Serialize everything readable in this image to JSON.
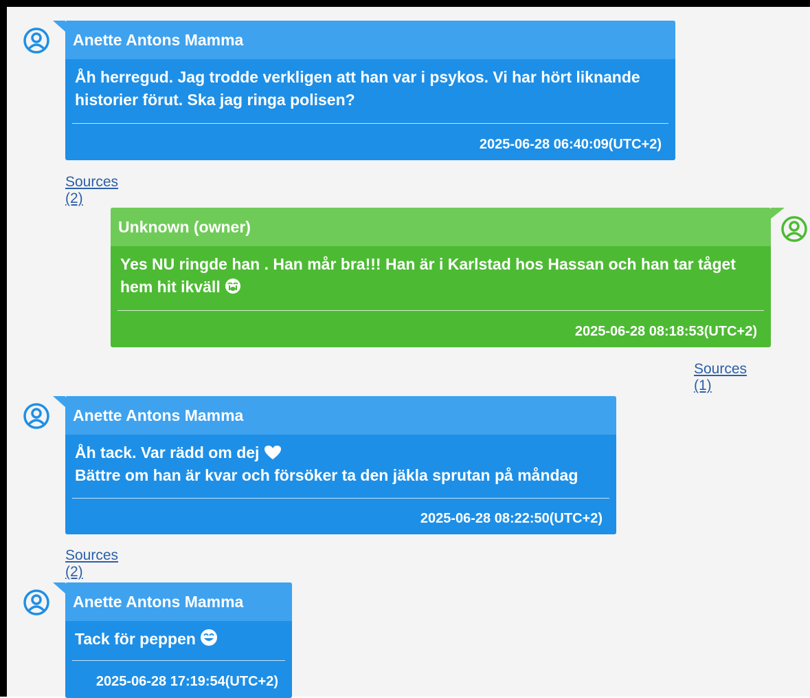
{
  "colors": {
    "incoming_header": "#3ea2ef",
    "incoming_body": "#1e8fe6",
    "outgoing_header": "#6fcb58",
    "outgoing_body": "#4dba34",
    "link": "#2b5fa8"
  },
  "messages": [
    {
      "direction": "incoming",
      "sender": "Anette Antons Mamma",
      "lines": [
        "Åh herregud. Jag trodde verkligen att han var i psykos. Vi har hört liknande",
        "historier förut. Ska jag ringa polisen?"
      ],
      "timestamp": "2025-06-28 06:40:09(UTC+2)",
      "sources": "Sources (2)",
      "avatar_icon": "user-avatar-icon"
    },
    {
      "direction": "outgoing",
      "sender": "Unknown (owner)",
      "lines": [
        "Yes NU ringde han . Han mår bra!!! Han är i Karlstad hos Hassan och han tar tåget",
        "hem hit ikväll"
      ],
      "emoji": "crying-face-emoji",
      "timestamp": "2025-06-28 08:18:53(UTC+2)",
      "sources": "Sources (1)",
      "avatar_icon": "user-avatar-icon"
    },
    {
      "direction": "incoming",
      "sender": "Anette Antons Mamma",
      "lines": [
        "Åh tack. Var rädd om dej",
        "Bättre om han är kvar och försöker  ta den jäkla sprutan på måndag"
      ],
      "emoji": "heart-emoji",
      "timestamp": "2025-06-28 08:22:50(UTC+2)",
      "sources": "Sources (2)",
      "avatar_icon": "user-avatar-icon"
    },
    {
      "direction": "incoming",
      "sender": "Anette Antons Mamma",
      "lines": [
        "Tack för peppen"
      ],
      "emoji": "smiling-face-emoji",
      "timestamp": "2025-06-28 17:19:54(UTC+2)",
      "avatar_icon": "user-avatar-icon"
    }
  ]
}
